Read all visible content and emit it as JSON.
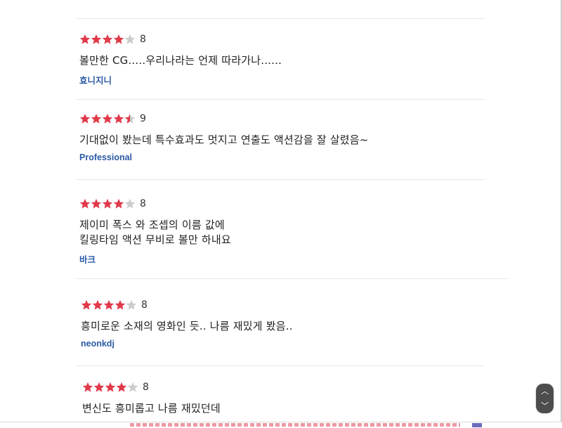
{
  "colors": {
    "star_filled": "#e03a4a",
    "star_empty": "#cccccc",
    "author": "#2b5aa6"
  },
  "reviews": [
    {
      "score": "8",
      "stars": 4,
      "text": "볼만한 CG.....우리나라는 언제 따라가나......",
      "author": "효니지니"
    },
    {
      "score": "9",
      "stars": 4.5,
      "text": "기대없이 봤는데 특수효과도 멋지고 연출도 액션감을 잘 살렸음~",
      "author": "Professional"
    },
    {
      "score": "8",
      "stars": 4,
      "text_lines": [
        "제이미 폭스 와 조셉의  이름 값에",
        "킬링타임 액션 무비로  볼만 하내요"
      ],
      "author": "바크"
    },
    {
      "score": "8",
      "stars": 4,
      "text": "흥미로운 소재의 영화인 듯.. 나름 재밌게 봤음..",
      "author": "neonkdj"
    },
    {
      "score": "8",
      "stars": 4,
      "text": "변신도 흥미롭고 나름 재밌던데"
    }
  ],
  "scroll_widget": {
    "up_icon": "chevron-up-icon",
    "down_icon": "chevron-down-icon"
  }
}
